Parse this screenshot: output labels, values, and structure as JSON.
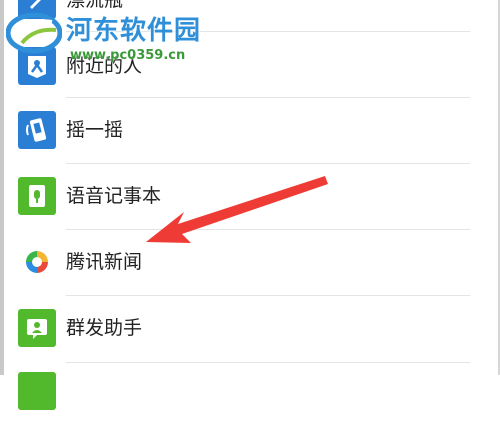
{
  "menu": {
    "items": [
      {
        "label": "漂流瓶",
        "icon": "drift-bottle-icon",
        "color": "#2a7fd4"
      },
      {
        "label": "附近的人",
        "icon": "nearby-people-icon",
        "color": "#2a7fd4"
      },
      {
        "label": "摇一摇",
        "icon": "shake-icon",
        "color": "#2a7fd4"
      },
      {
        "label": "语音记事本",
        "icon": "voice-notepad-icon",
        "color": "#52b82c"
      },
      {
        "label": "腾讯新闻",
        "icon": "tencent-news-icon",
        "color": "#ffffff"
      },
      {
        "label": "群发助手",
        "icon": "mass-message-icon",
        "color": "#52b82c"
      }
    ]
  },
  "watermark": {
    "title": "河东软件园",
    "url": "www.pc0359.cn"
  },
  "annotation": {
    "arrow_color": "#ef3b36"
  }
}
